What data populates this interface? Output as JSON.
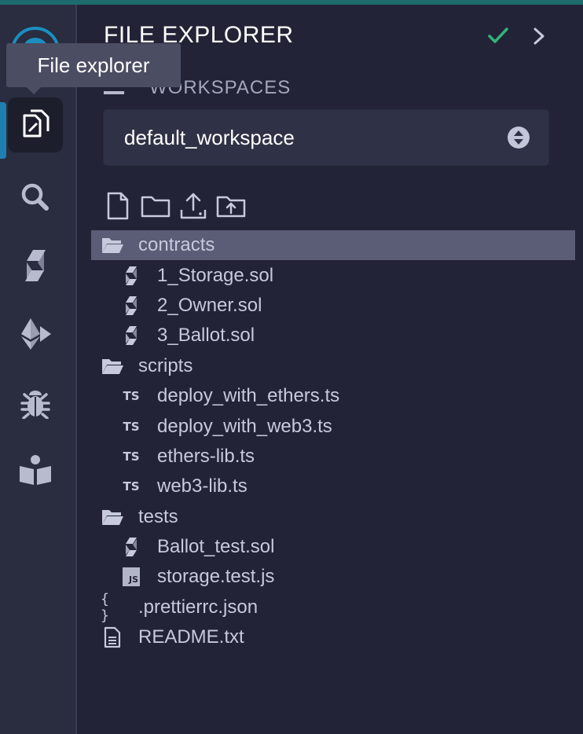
{
  "tooltip": "File explorer",
  "panel": {
    "title": "FILE EXPLORER",
    "workspaces_label": "WORKSPACES",
    "workspace_selected": "default_workspace"
  },
  "sidebar_icons": [
    "file-explorer-icon",
    "search-icon",
    "solidity-compiler-icon",
    "deploy-run-icon",
    "debugger-icon",
    "learneth-icon"
  ],
  "toolbar_icons": [
    "new-file-icon",
    "new-folder-icon",
    "publish-gist-icon",
    "upload-folder-icon"
  ],
  "tree": [
    {
      "label": "contracts",
      "type": "folder",
      "depth": 0,
      "selected": true
    },
    {
      "label": "1_Storage.sol",
      "type": "sol",
      "depth": 1
    },
    {
      "label": "2_Owner.sol",
      "type": "sol",
      "depth": 1
    },
    {
      "label": "3_Ballot.sol",
      "type": "sol",
      "depth": 1
    },
    {
      "label": "scripts",
      "type": "folder",
      "depth": 0
    },
    {
      "label": "deploy_with_ethers.ts",
      "type": "ts",
      "depth": 1
    },
    {
      "label": "deploy_with_web3.ts",
      "type": "ts",
      "depth": 1
    },
    {
      "label": "ethers-lib.ts",
      "type": "ts",
      "depth": 1
    },
    {
      "label": "web3-lib.ts",
      "type": "ts",
      "depth": 1
    },
    {
      "label": "tests",
      "type": "folder",
      "depth": 0
    },
    {
      "label": "Ballot_test.sol",
      "type": "sol",
      "depth": 1
    },
    {
      "label": "storage.test.js",
      "type": "js",
      "depth": 1
    },
    {
      "label": ".prettierrc.json",
      "type": "json",
      "depth": 0
    },
    {
      "label": "README.txt",
      "type": "txt",
      "depth": 0
    }
  ],
  "icon_glyphs": {
    "ts": "TS",
    "js": "JS",
    "json": "{ }"
  },
  "colors": {
    "background": "#222336",
    "iconbar": "#2a2c3f",
    "accent": "#1e7fb0",
    "check": "#34b37a",
    "selected_row": "#5b5c75"
  }
}
